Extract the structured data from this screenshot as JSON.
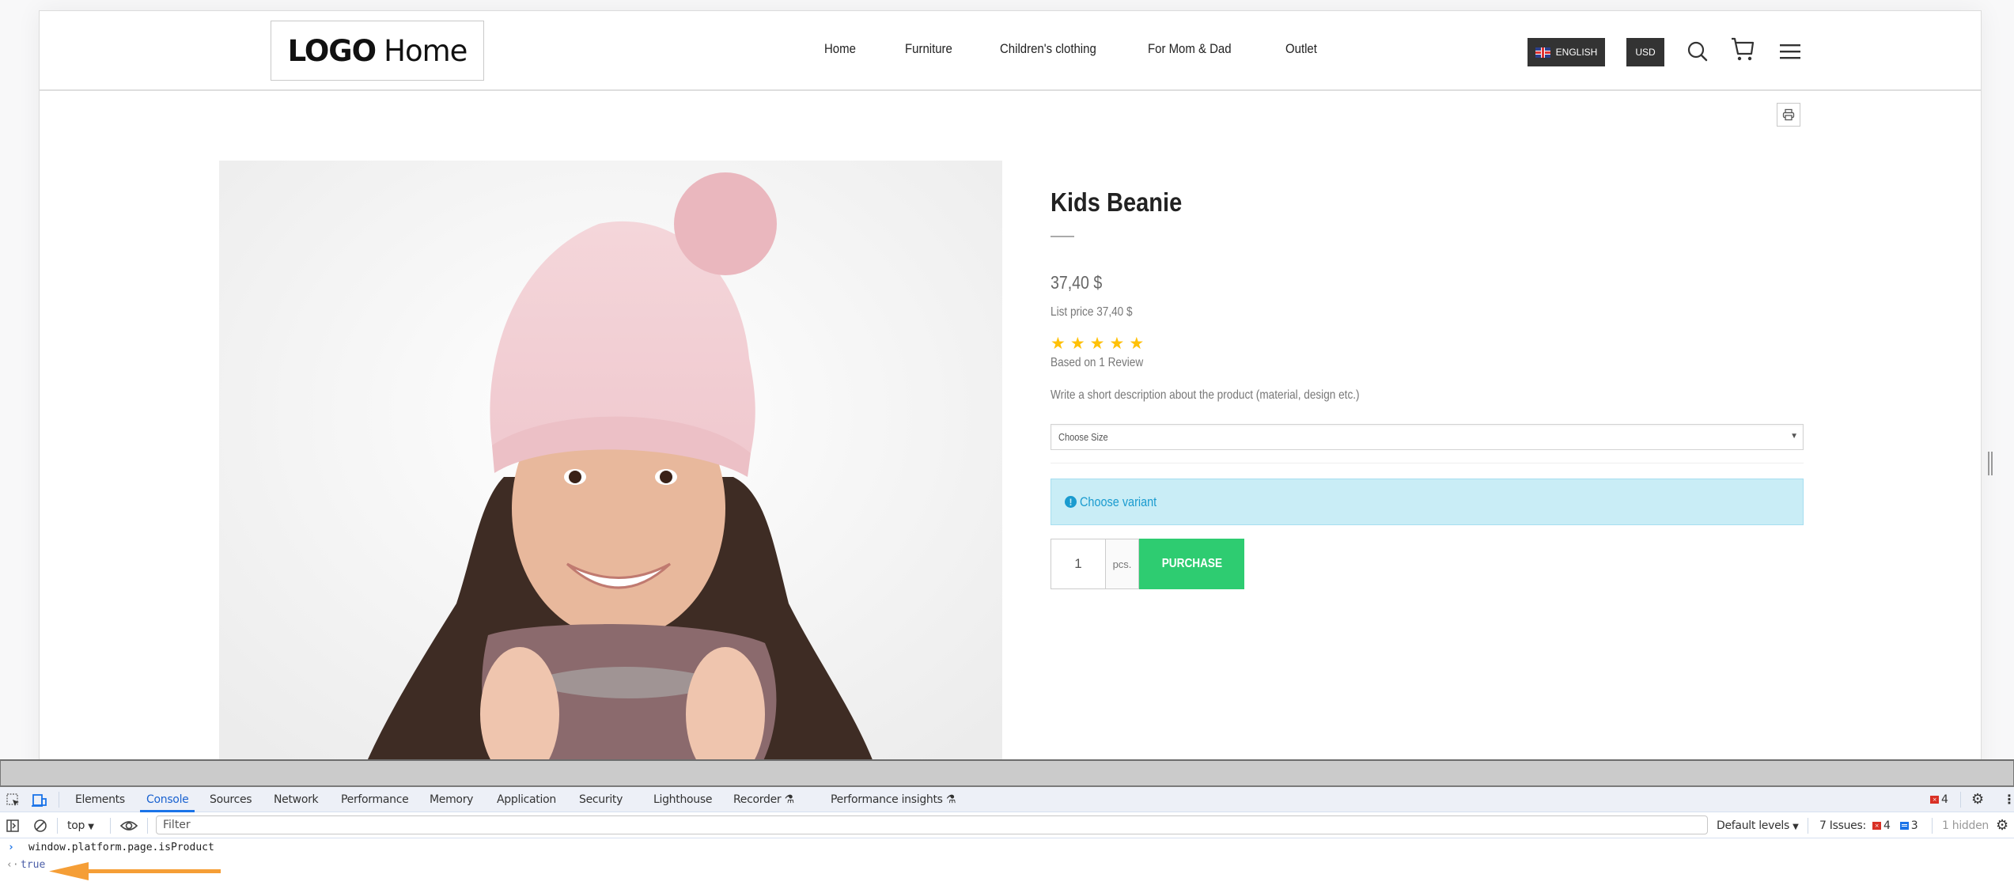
{
  "header": {
    "logo": {
      "bold": "LOGO",
      "light": "Home"
    },
    "nav": [
      "Home",
      "Furniture",
      "Children's clothing",
      "For Mom & Dad",
      "Outlet"
    ],
    "language_label": "ENGLISH",
    "currency_label": "USD",
    "icons": [
      "search-icon",
      "cart-icon",
      "menu-icon"
    ]
  },
  "product": {
    "title": "Kids Beanie",
    "price": "37,40 $",
    "list_price": "List price 37,40 $",
    "rating": 5,
    "rating_max": 5,
    "review_text": "Based on 1 Review",
    "description": "Write a short description about the product (material, design etc.)",
    "size_select": {
      "selected": "Choose Size"
    },
    "alert_text": "Choose variant",
    "quantity": "1",
    "quantity_unit": "pcs.",
    "purchase_label": "PURCHASE",
    "image_alt": "Girl wearing pink knitted beanie with pom-pom and scarf"
  },
  "colors": {
    "purchase": "#2ecc71",
    "star": "#ffc107",
    "alert_bg": "#c9edf6",
    "alert_text": "#1a9bcf",
    "header_button": "#333333",
    "devtools_active": "#1a73e8",
    "annotation_arrow": "#f59e36"
  },
  "devtools": {
    "tabs": [
      "Elements",
      "Console",
      "Sources",
      "Network",
      "Performance",
      "Memory",
      "Application",
      "Security",
      "Lighthouse",
      "Recorder",
      "Performance insights"
    ],
    "active_tab": "Console",
    "error_count": "4",
    "toolbar": {
      "context": "top",
      "filter_placeholder": "Filter",
      "levels": "Default levels",
      "issues_label": "7 Issues:",
      "issues_errors": "4",
      "issues_info": "3",
      "hidden": "1 hidden"
    },
    "console": {
      "input": "window.platform.page.isProduct",
      "output": "true"
    }
  }
}
